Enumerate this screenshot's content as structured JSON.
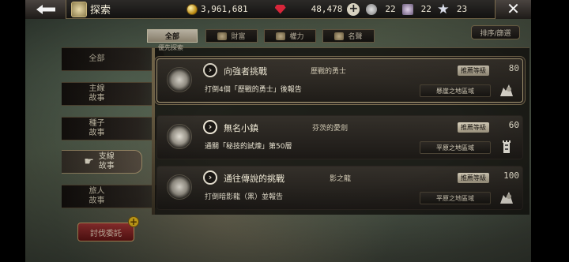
{
  "header": {
    "title": "探索",
    "coins": "3,961,681",
    "gems": "48,478",
    "stat1": "22",
    "stat2": "22",
    "stat3": "23"
  },
  "tabs": [
    {
      "label": "全部",
      "icon": "none",
      "active": true
    },
    {
      "label": "財富",
      "icon": "treasure-icon",
      "active": false
    },
    {
      "label": "權力",
      "icon": "crest-icon",
      "active": false
    },
    {
      "label": "名聲",
      "icon": "emblem-icon",
      "active": false
    }
  ],
  "sort_label": "排序/篩選",
  "section_label": "優先探索",
  "sidebar": {
    "items": [
      {
        "label": "全部",
        "active": false
      },
      {
        "label": "主線\n故事",
        "active": false
      },
      {
        "label": "種子\n故事",
        "active": false
      },
      {
        "label": "支線\n故事",
        "active": true
      },
      {
        "label": "旅人\n故事",
        "active": false
      }
    ],
    "quest_button": "討伐委託"
  },
  "quests": [
    {
      "name": "向強者挑戰",
      "subtitle": "歷戰的勇士",
      "rec_label": "推薦等級",
      "level": "80",
      "description": "打倒4個「歷戰的勇士」後報告",
      "region": "懸崖之地區域",
      "region_icon": "cliff-icon",
      "featured": true
    },
    {
      "name": "無名小鎮",
      "subtitle": "芬茨的愛劍",
      "rec_label": "推薦等級",
      "level": "60",
      "description": "通關「秘技的試煉」第50層",
      "region": "平原之地區域",
      "region_icon": "tower-icon",
      "featured": false
    },
    {
      "name": "通往傳說的挑戰",
      "subtitle": "影之龍",
      "rec_label": "推薦等級",
      "level": "100",
      "description": "打倒暗影龍（黑）並報告",
      "region": "平原之地區域",
      "region_icon": "cliff-icon",
      "featured": false
    }
  ]
}
